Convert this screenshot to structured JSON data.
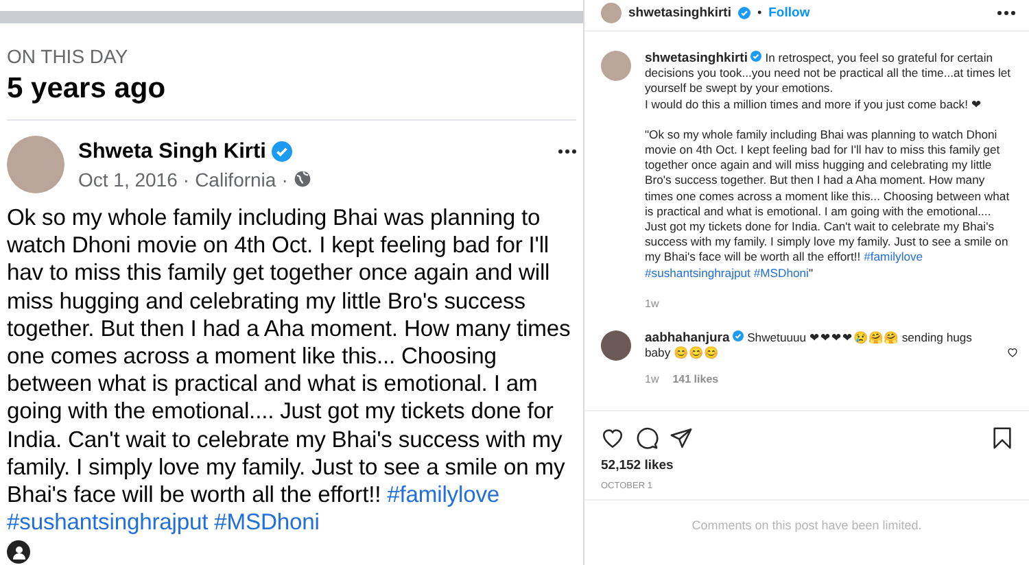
{
  "memory": {
    "eyebrow": "ON THIS DAY",
    "heading": "5 years ago",
    "post": {
      "author": "Shweta Singh Kirti",
      "verified": true,
      "date": "Oct 1, 2016",
      "location": "California",
      "separator": "·",
      "segments": [
        {
          "kind": "text",
          "text": "Ok so my whole family including Bhai was planning to watch Dhoni movie on 4th Oct. I kept feeling bad for I'll hav to miss this family get together once again and will miss hugging and celebrating my little Bro's success together. But then I had a Aha moment. How many times one comes across a moment like this... Choosing between what is practical and what is emotional. I am going with the emotional.... Just got my tickets done for India. Can't wait to celebrate my Bhai's success with my family. I simply love my family. Just to see a smile on my Bhai's face will be worth all the effort!!"
        },
        {
          "kind": "hashtag",
          "text": "#familylove"
        },
        {
          "kind": "hashtag",
          "text": "#sushantsinghrajput"
        },
        {
          "kind": "hashtag",
          "text": "#MSDhoni"
        }
      ]
    }
  },
  "instagram": {
    "header": {
      "username": "shwetasinghkirti",
      "verified": true,
      "dot": "•",
      "follow": "Follow"
    },
    "caption": {
      "username": "shwetasinghkirti",
      "verified": true,
      "paragraphs": [
        [
          {
            "kind": "text",
            "text": "In retrospect, you feel so grateful for certain decisions you took...you need not be practical all the time...at times let yourself be swept by your emotions."
          }
        ],
        [
          {
            "kind": "text",
            "text": "I would do this a million times and more if you just come back! ❤"
          }
        ],
        [
          {
            "kind": "text",
            "text": "\"Ok so my whole family including Bhai was planning to watch Dhoni movie on 4th Oct. I kept feeling bad for I'll hav to miss this family get together once again and will miss hugging and celebrating my little Bro's success together. But then I had a Aha moment. How many times one comes across a moment like this... Choosing between what is practical and what is emotional. I am going with the emotional.... Just got my tickets done for India. Can't wait to celebrate my Bhai's success with my family. I simply love my family. Just to see a smile on my Bhai's face will be worth all the effort!!"
          },
          {
            "kind": "hashtag",
            "text": "#familylove"
          },
          {
            "kind": "hashtag",
            "text": "#sushantsinghrajput"
          },
          {
            "kind": "hashtag",
            "text": "#MSDhoni"
          },
          {
            "kind": "text",
            "text": "\""
          }
        ]
      ],
      "time": "1w"
    },
    "comments": [
      {
        "username": "aabhahanjura",
        "verified": true,
        "text": "Shwetuuuu ❤❤❤❤😢🤗🤗 sending hugs baby 😊😊😊",
        "time": "1w",
        "likes": "141 likes",
        "liked": false
      }
    ],
    "likes": "52,152 likes",
    "date": "OCTOBER 1",
    "saved": false,
    "notice": "Comments on this post have been limited."
  }
}
